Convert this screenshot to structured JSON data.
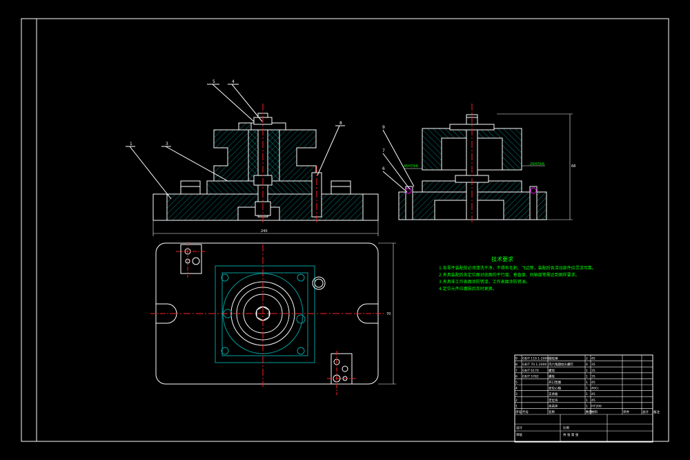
{
  "drawing": {
    "background": "#000000",
    "line_color": "#ffffff",
    "hatch_color": "#00a0a0",
    "center_color": "#ff2020",
    "dim_color": "#ffffff",
    "text_color": "#00ff00",
    "highlight_color": "#ff00ff"
  },
  "balloons": [
    "5",
    "4",
    "8",
    "1",
    "3",
    "9",
    "7",
    "6"
  ],
  "dimensions": {
    "base_width": "240",
    "plan_height": "70",
    "side_height": "68",
    "callout_a": "45H7/k6",
    "callout_b": "20H7/k6"
  },
  "notes": {
    "title": "技术要求",
    "lines": [
      "1.各零件装配前必须清洗干净，不得有毛刺、飞边等，装配后各活动部件应灵活可靠。",
      "2.夹具装配后各定位面对底面的平行度、垂直度、同轴度等需达到图样要求。",
      "3.夹具非工作表面涂防锈漆，工作表面涂防锈油。",
      "4.定位元件应磨损后及时更换。"
    ]
  },
  "parts_list": {
    "rows": [
      [
        "9",
        "GB/T 119.1-2000",
        "圆柱销",
        "2",
        "45"
      ],
      [
        "8",
        "GB/T 70.1-2000",
        "内六角圆柱头螺钉",
        "4",
        "35"
      ],
      [
        "7",
        "GB/T 6170",
        "螺母",
        "1",
        "35"
      ],
      [
        "6",
        "GB/T 5782",
        "螺栓",
        "1",
        "35"
      ],
      [
        "5",
        "",
        "开口垫圈",
        "1",
        "45"
      ],
      [
        "4",
        "",
        "定位心轴",
        "1",
        "40Cr"
      ],
      [
        "3",
        "",
        "支承板",
        "1",
        "45"
      ],
      [
        "2",
        "",
        "定位块",
        "1",
        "45"
      ],
      [
        "1",
        "",
        "夹具体",
        "1",
        "HT200"
      ]
    ],
    "header": [
      "序号",
      "代号",
      "名称",
      "数量",
      "材料",
      "单件",
      "总计",
      "备注"
    ],
    "title_block": {
      "school": "",
      "design": "设计",
      "check": "审核",
      "scale": "比例",
      "sheet": "共 张 第 张"
    }
  }
}
